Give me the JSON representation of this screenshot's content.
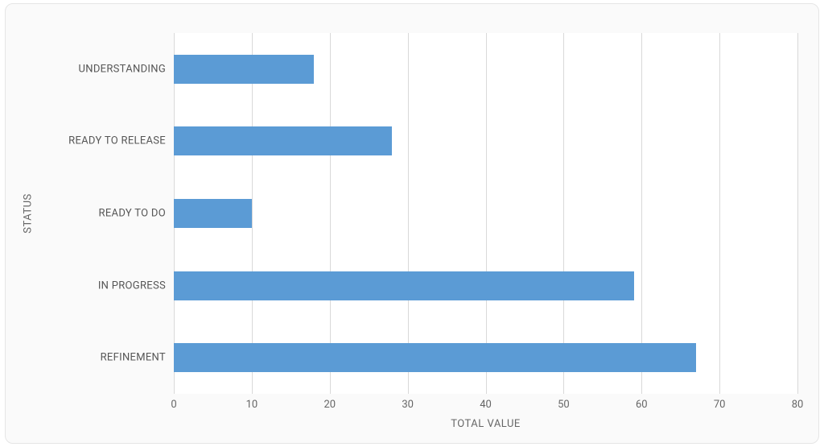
{
  "chart_data": {
    "type": "bar",
    "orientation": "horizontal",
    "categories": [
      "UNDERSTANDING",
      "READY TO RELEASE",
      "READY TO DO",
      "IN PROGRESS",
      "REFINEMENT"
    ],
    "values": [
      18,
      28,
      10,
      59,
      67
    ],
    "xlabel": "TOTAL VALUE",
    "ylabel": "STATUS",
    "xlim": [
      0,
      80
    ],
    "xticks": [
      0,
      10,
      20,
      30,
      40,
      50,
      60,
      70,
      80
    ],
    "bar_color": "#5b9bd5",
    "grid": true
  }
}
